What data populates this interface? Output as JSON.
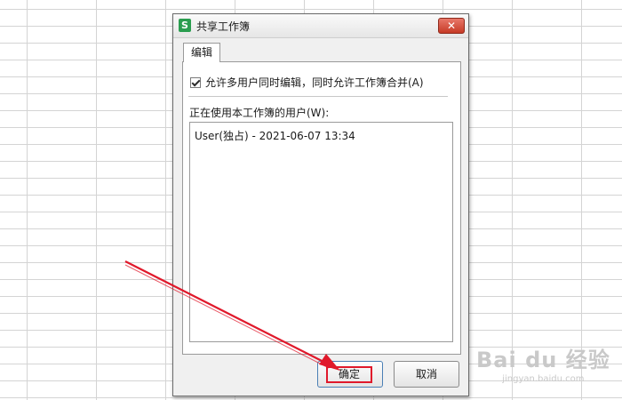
{
  "dialog": {
    "title": "共享工作簿",
    "app_icon_letter": "S",
    "close_glyph": "✕"
  },
  "tabs": [
    {
      "label": "编辑",
      "selected": true
    }
  ],
  "edit_tab": {
    "allow_multiuser_label": "允许多用户同时编辑，同时允许工作簿合并(A)",
    "allow_multiuser_checked": true,
    "users_label": "正在使用本工作簿的用户(W):",
    "users": [
      "User(独占) - 2021-06-07 13:34"
    ]
  },
  "buttons": {
    "ok_label": "确定",
    "cancel_label": "取消"
  },
  "watermark": {
    "main": "Bai du 经验",
    "sub": "jingyan.baidu.com"
  },
  "colors": {
    "app_icon": "#2a9d4f",
    "annotation_red": "#e0192b",
    "close_button": "#c63a26"
  }
}
